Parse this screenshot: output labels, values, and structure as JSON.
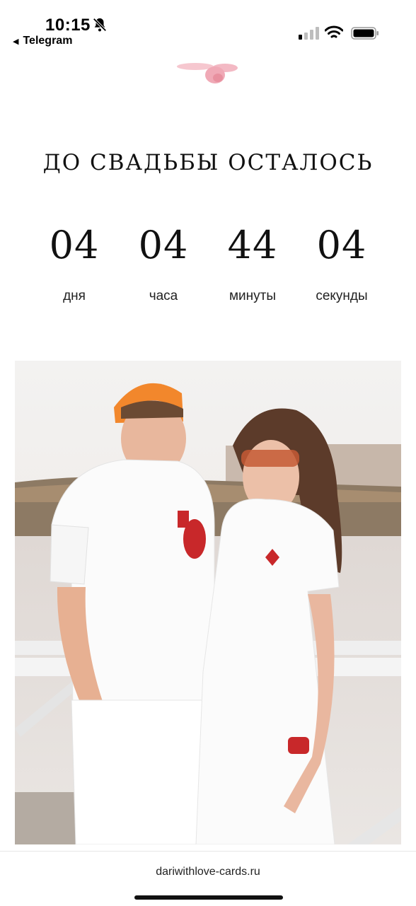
{
  "status_bar": {
    "time": "10:15",
    "back_app": "Telegram",
    "icons": [
      "bell-slash-icon",
      "signal-icon",
      "wifi-icon",
      "battery-icon"
    ]
  },
  "invitation": {
    "heading": "ДО СВАДЬБЫ ОСТАЛОСЬ",
    "countdown": [
      {
        "value": "04",
        "label": "дня"
      },
      {
        "value": "04",
        "label": "часа"
      },
      {
        "value": "44",
        "label": "минуты"
      },
      {
        "value": "04",
        "label": "секунды"
      }
    ]
  },
  "browser": {
    "url": "dariwithlove-cards.ru"
  }
}
